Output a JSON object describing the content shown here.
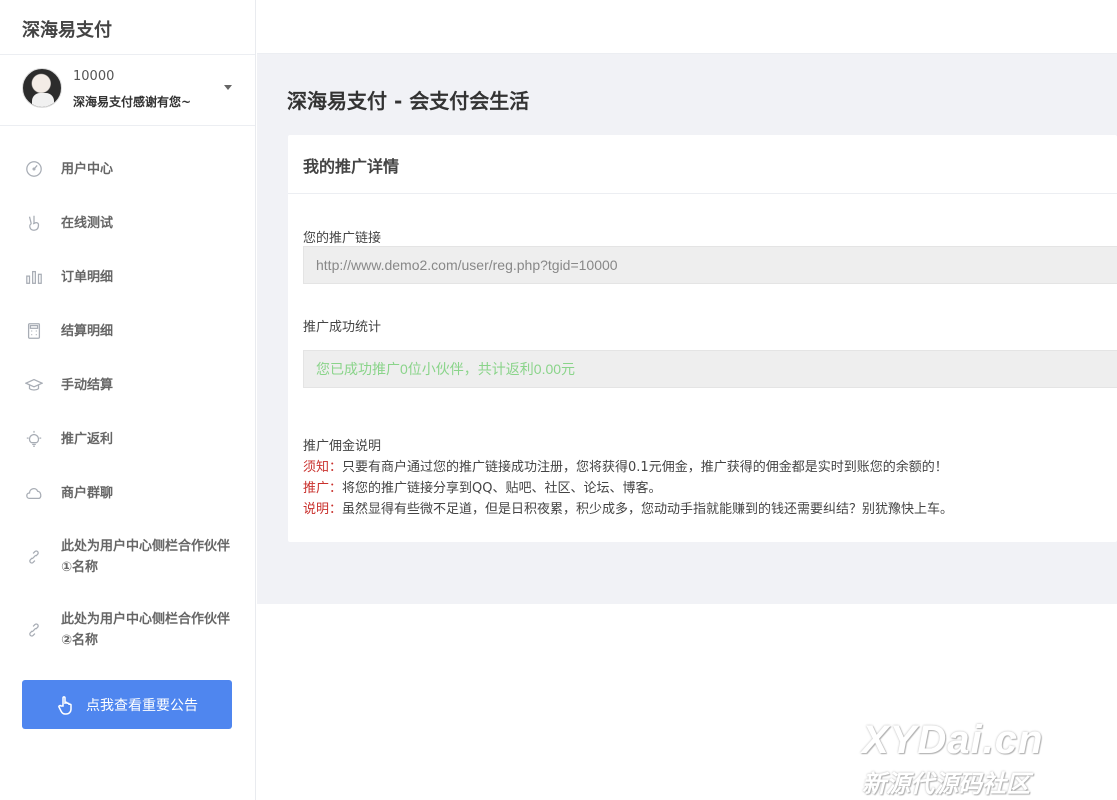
{
  "sidebar": {
    "brand": "深海易支付",
    "user": {
      "id": "10000",
      "name": "深海易支付感谢有您~"
    },
    "items": [
      {
        "label": "用户中心",
        "icon": "dashboard-icon"
      },
      {
        "label": "在线测试",
        "icon": "hand-peace-icon"
      },
      {
        "label": "订单明细",
        "icon": "bar-chart-icon"
      },
      {
        "label": "结算明细",
        "icon": "calculator-icon"
      },
      {
        "label": "手动结算",
        "icon": "graduation-cap-icon"
      },
      {
        "label": "推广返利",
        "icon": "lightbulb-icon"
      },
      {
        "label": "商户群聊",
        "icon": "cloud-icon"
      },
      {
        "label": "此处为用户中心侧栏合作伙伴①名称",
        "icon": "link-icon"
      },
      {
        "label": "此处为用户中心侧栏合作伙伴②名称",
        "icon": "link-icon"
      }
    ],
    "notice_button": "点我查看重要公告"
  },
  "main": {
    "title": "深海易支付 - 会支付会生活",
    "card": {
      "header": "我的推广详情",
      "link_label": "您的推广链接",
      "link_value": "http://www.demo2.com/user/reg.php?tgid=10000",
      "stats_label": "推广成功统计",
      "stats_value": "您已成功推广0位小伙伴，共计返利0.00元",
      "desc_title": "推广佣金说明",
      "desc": [
        {
          "key": "须知：",
          "text": "只要有商户通过您的推广链接成功注册，您将获得0.1元佣金，推广获得的佣金都是实时到账您的余额的！"
        },
        {
          "key": "推广：",
          "text": "将您的推广链接分享到QQ、贴吧、社区、论坛、博客。"
        },
        {
          "key": "说明：",
          "text": "虽然显得有些微不足道，但是日积夜累，积少成多，您动动手指就能赚到的钱还需要纠结？别犹豫快上车。"
        }
      ]
    }
  },
  "watermark": {
    "line1": "XYDai.cn",
    "line2": "新源代源码社区"
  },
  "colors": {
    "primary": "#4f86ef",
    "success_text": "#8ad48a",
    "accent_red": "#c9302c"
  }
}
